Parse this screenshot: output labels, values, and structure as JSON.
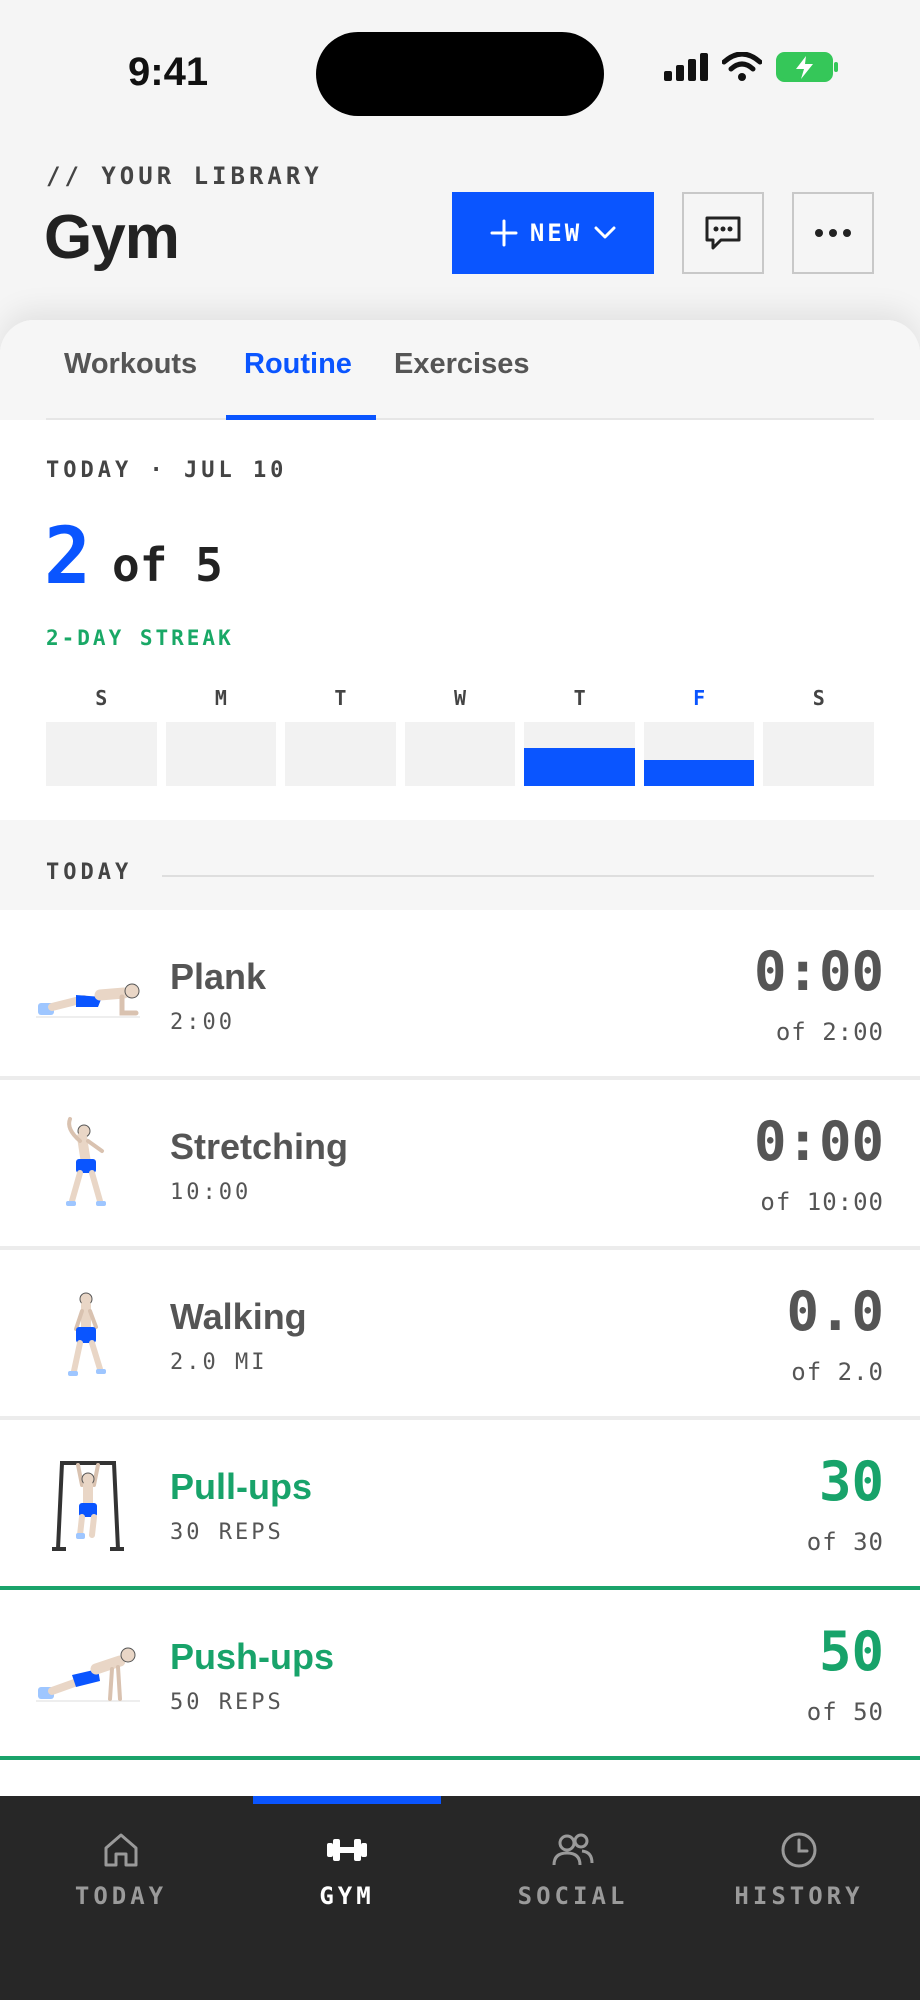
{
  "status_bar": {
    "time": "9:41"
  },
  "header": {
    "eyebrow": "// YOUR LIBRARY",
    "title": "Gym",
    "new_label": "NEW"
  },
  "tabs": [
    {
      "label": "Workouts",
      "active": false
    },
    {
      "label": "Routine",
      "active": true
    },
    {
      "label": "Exercises",
      "active": false
    }
  ],
  "today_card": {
    "date_label": "TODAY · JUL 10",
    "done": "2",
    "total_text": "of 5",
    "streak": "2-DAY STREAK",
    "week": [
      {
        "letter": "S",
        "progress": 0
      },
      {
        "letter": "M",
        "progress": 0
      },
      {
        "letter": "T",
        "progress": 0
      },
      {
        "letter": "W",
        "progress": 0
      },
      {
        "letter": "T",
        "progress": 0.6
      },
      {
        "letter": "F",
        "progress": 0.4,
        "current": true
      },
      {
        "letter": "S",
        "progress": 0
      }
    ]
  },
  "section": {
    "label": "TODAY"
  },
  "exercises": [
    {
      "name": "Plank",
      "target": "2:00",
      "value": "0:00",
      "of": "of 2:00",
      "done": false,
      "icon": "plank-figure-icon"
    },
    {
      "name": "Stretching",
      "target": "10:00",
      "value": "0:00",
      "of": "of 10:00",
      "done": false,
      "icon": "stretching-figure-icon"
    },
    {
      "name": "Walking",
      "target": "2.0 MI",
      "value": "0.0",
      "of": "of 2.0",
      "done": false,
      "icon": "walking-figure-icon"
    },
    {
      "name": "Pull-ups",
      "target": "30 REPS",
      "value": "30",
      "of": "of 30",
      "done": true,
      "icon": "pullup-figure-icon"
    },
    {
      "name": "Push-ups",
      "target": "50 REPS",
      "value": "50",
      "of": "of 50",
      "done": true,
      "icon": "pushup-figure-icon"
    }
  ],
  "nav": [
    {
      "label": "TODAY",
      "icon": "home-icon",
      "active": false
    },
    {
      "label": "GYM",
      "icon": "dumbbell-icon",
      "active": true
    },
    {
      "label": "SOCIAL",
      "icon": "people-icon",
      "active": false
    },
    {
      "label": "HISTORY",
      "icon": "clock-icon",
      "active": false
    }
  ],
  "colors": {
    "accent": "#0a55ff",
    "success": "#18a36a",
    "nav_bg": "#272727"
  }
}
